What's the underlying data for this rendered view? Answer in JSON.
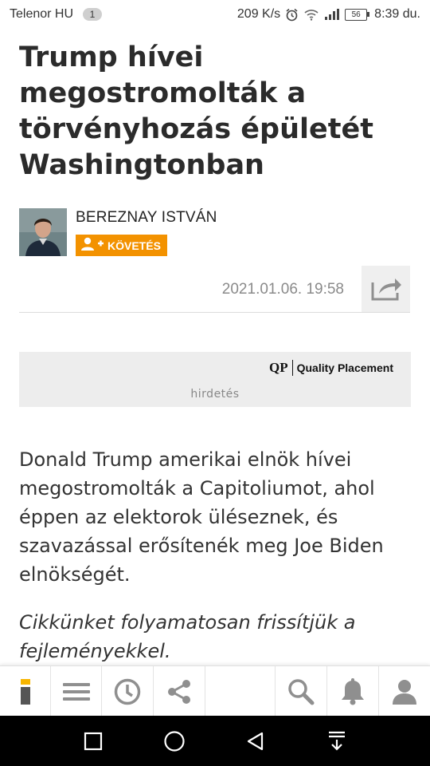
{
  "status_bar": {
    "carrier": "Telenor HU",
    "notif_count": "1",
    "speed": "209 K/s",
    "battery": "56",
    "time": "8:39 du."
  },
  "article": {
    "title": "Trump hívei megostromolták a törvényhozás épületét Washingtonban",
    "author": "BEREZNAY ISTVÁN",
    "follow_label": "KÖVETÉS",
    "date": "2021.01.06. 19:58",
    "lead": "Donald Trump amerikai elnök hívei megostromolták a Capitoliumot, ahol éppen az elektorok üléseznek, és szavazással erősítenék meg Joe Biden elnökségét.",
    "update_note": "Cikkünket folyamatosan frissítjük a fejleményekkel."
  },
  "ad": {
    "logo_mark": "QP",
    "brand": "Quality Placement",
    "label": "hirdetés"
  },
  "toolbar": {
    "items": [
      "logo-icon",
      "menu-icon",
      "clock-icon",
      "share-icon",
      "search-icon",
      "bell-icon",
      "user-icon"
    ]
  },
  "nav": {
    "items": [
      "recent-apps-icon",
      "home-icon",
      "back-icon",
      "notification-shade-icon"
    ]
  },
  "colors": {
    "accent": "#f39200",
    "logo_yellow": "#f7b500",
    "icon_gray": "#8f8f8f"
  }
}
